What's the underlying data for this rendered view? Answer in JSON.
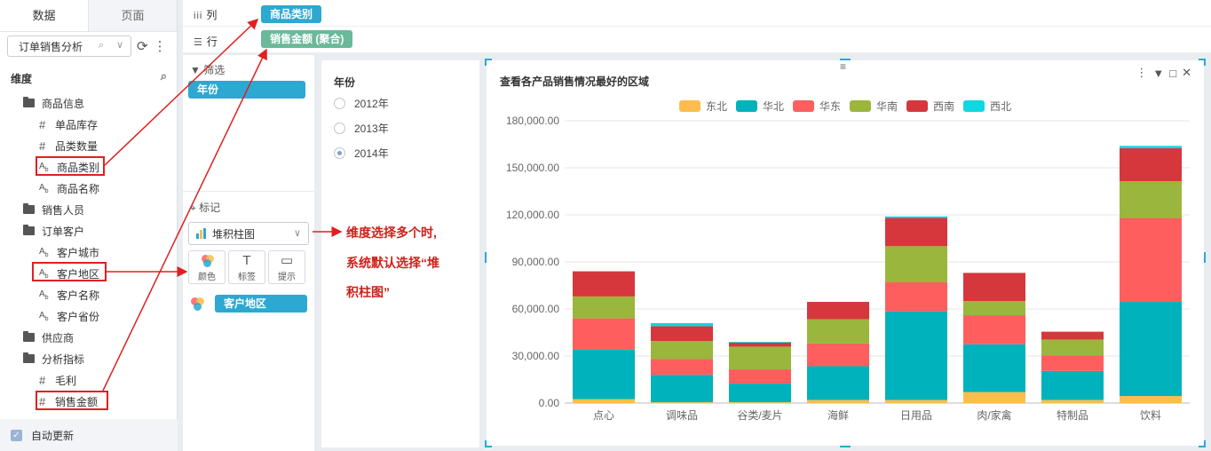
{
  "left_panel": {
    "tabs": [
      "数据",
      "页面"
    ],
    "dataset": "订单销售分析",
    "dimension_header": "维度",
    "tree": [
      {
        "type": "folder",
        "label": "商品信息",
        "level": 1
      },
      {
        "type": "measure",
        "label": "单品库存",
        "level": 2
      },
      {
        "type": "measure",
        "label": "品类数量",
        "level": 2
      },
      {
        "type": "text",
        "label": "商品类别",
        "level": 2,
        "highlighted": true
      },
      {
        "type": "text",
        "label": "商品名称",
        "level": 2
      },
      {
        "type": "folder",
        "label": "销售人员",
        "level": 1
      },
      {
        "type": "folder",
        "label": "订单客户",
        "level": 1
      },
      {
        "type": "text",
        "label": "客户城市",
        "level": 2
      },
      {
        "type": "text",
        "label": "客户地区",
        "level": 2,
        "highlighted": true
      },
      {
        "type": "text",
        "label": "客户名称",
        "level": 2
      },
      {
        "type": "text",
        "label": "客户省份",
        "level": 2
      },
      {
        "type": "folder",
        "label": "供应商",
        "level": 1
      },
      {
        "type": "folder",
        "label": "分析指标",
        "level": 1
      },
      {
        "type": "measure",
        "label": "毛利",
        "level": 2
      },
      {
        "type": "measure",
        "label": "销售金额",
        "level": 2,
        "highlighted": true
      }
    ],
    "auto_update": "自动更新"
  },
  "shelves": {
    "columns_label": "列",
    "rows_label": "行",
    "columns_pill": "商品类别",
    "rows_pill": "销售金额 (聚合)",
    "columns_pill_color": "#2ca8d2",
    "rows_pill_color": "#6ab99a"
  },
  "config": {
    "filter_label": "筛选",
    "filter_pill": "年份",
    "mark_label": "标记",
    "chart_type": "堆积柱图",
    "mark_buttons": [
      "颜色",
      "标签",
      "提示"
    ],
    "color_field": "客户地区"
  },
  "annotation": {
    "lines": [
      "维度选择多个时,",
      "系统默认选择“堆",
      "积柱图”"
    ],
    "color": "#d0201a"
  },
  "year_filter": {
    "title": "年份",
    "options": [
      "2012年",
      "2013年",
      "2014年"
    ],
    "selected": "2014年"
  },
  "chart_data": {
    "type": "bar",
    "stacked": true,
    "title": "查看各产品销售情况最好的区域",
    "categories": [
      "点心",
      "调味品",
      "谷类/麦片",
      "海鲜",
      "日用品",
      "肉/家禽",
      "特制品",
      "饮料"
    ],
    "ylim": [
      0,
      180000
    ],
    "yticks": [
      "0.00",
      "30,000.00",
      "60,000.00",
      "90,000.00",
      "120,000.00",
      "150,000.00",
      "180,000.00"
    ],
    "legend_position": "top-center",
    "grid": true,
    "series": [
      {
        "name": "东北",
        "color": "#fcbd4d",
        "values": [
          2500,
          500,
          500,
          2000,
          2000,
          7000,
          2000,
          4500
        ]
      },
      {
        "name": "华北",
        "color": "#00b2bb",
        "values": [
          31500,
          17500,
          12000,
          21500,
          56500,
          30500,
          18500,
          60000
        ]
      },
      {
        "name": "华东",
        "color": "#fe5e5e",
        "values": [
          20000,
          10000,
          9000,
          14500,
          18500,
          18500,
          10000,
          53500
        ]
      },
      {
        "name": "华南",
        "color": "#9bb63c",
        "values": [
          14000,
          11500,
          14500,
          15500,
          23000,
          9000,
          10000,
          23500
        ]
      },
      {
        "name": "西南",
        "color": "#d6373c",
        "values": [
          16000,
          9500,
          2500,
          11000,
          18000,
          18000,
          5000,
          21000
        ]
      },
      {
        "name": "西北",
        "color": "#10d8e2",
        "values": [
          0,
          2000,
          500,
          0,
          1000,
          0,
          0,
          1500
        ]
      }
    ]
  }
}
